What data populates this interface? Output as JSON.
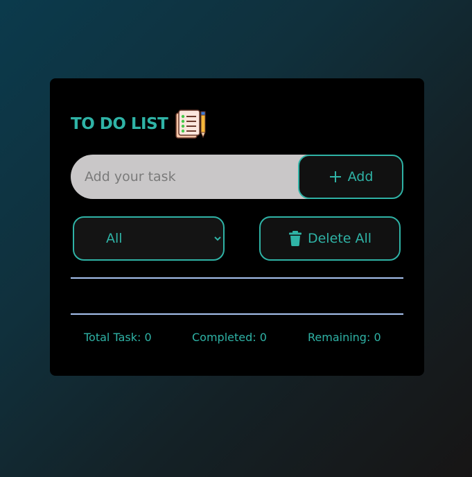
{
  "app": {
    "title": "TO DO LIST",
    "title_icon": "checklist-notepad-pencil-icon"
  },
  "input": {
    "placeholder": "Add your task",
    "value": ""
  },
  "add_button": {
    "icon": "plus-icon",
    "label": "Add"
  },
  "filter": {
    "selected": "All",
    "options": [
      "All"
    ]
  },
  "delete_button": {
    "icon": "trash-icon",
    "label": "Delete All"
  },
  "tasks": [],
  "stats": {
    "total": "Total Task: 0",
    "completed": "Completed: 0",
    "remaining": "Remaining: 0"
  },
  "colors": {
    "accent": "#2fb3a6",
    "card_background": "#000000",
    "input_background": "#c9c7c8",
    "divider": "#a9c4f2"
  }
}
